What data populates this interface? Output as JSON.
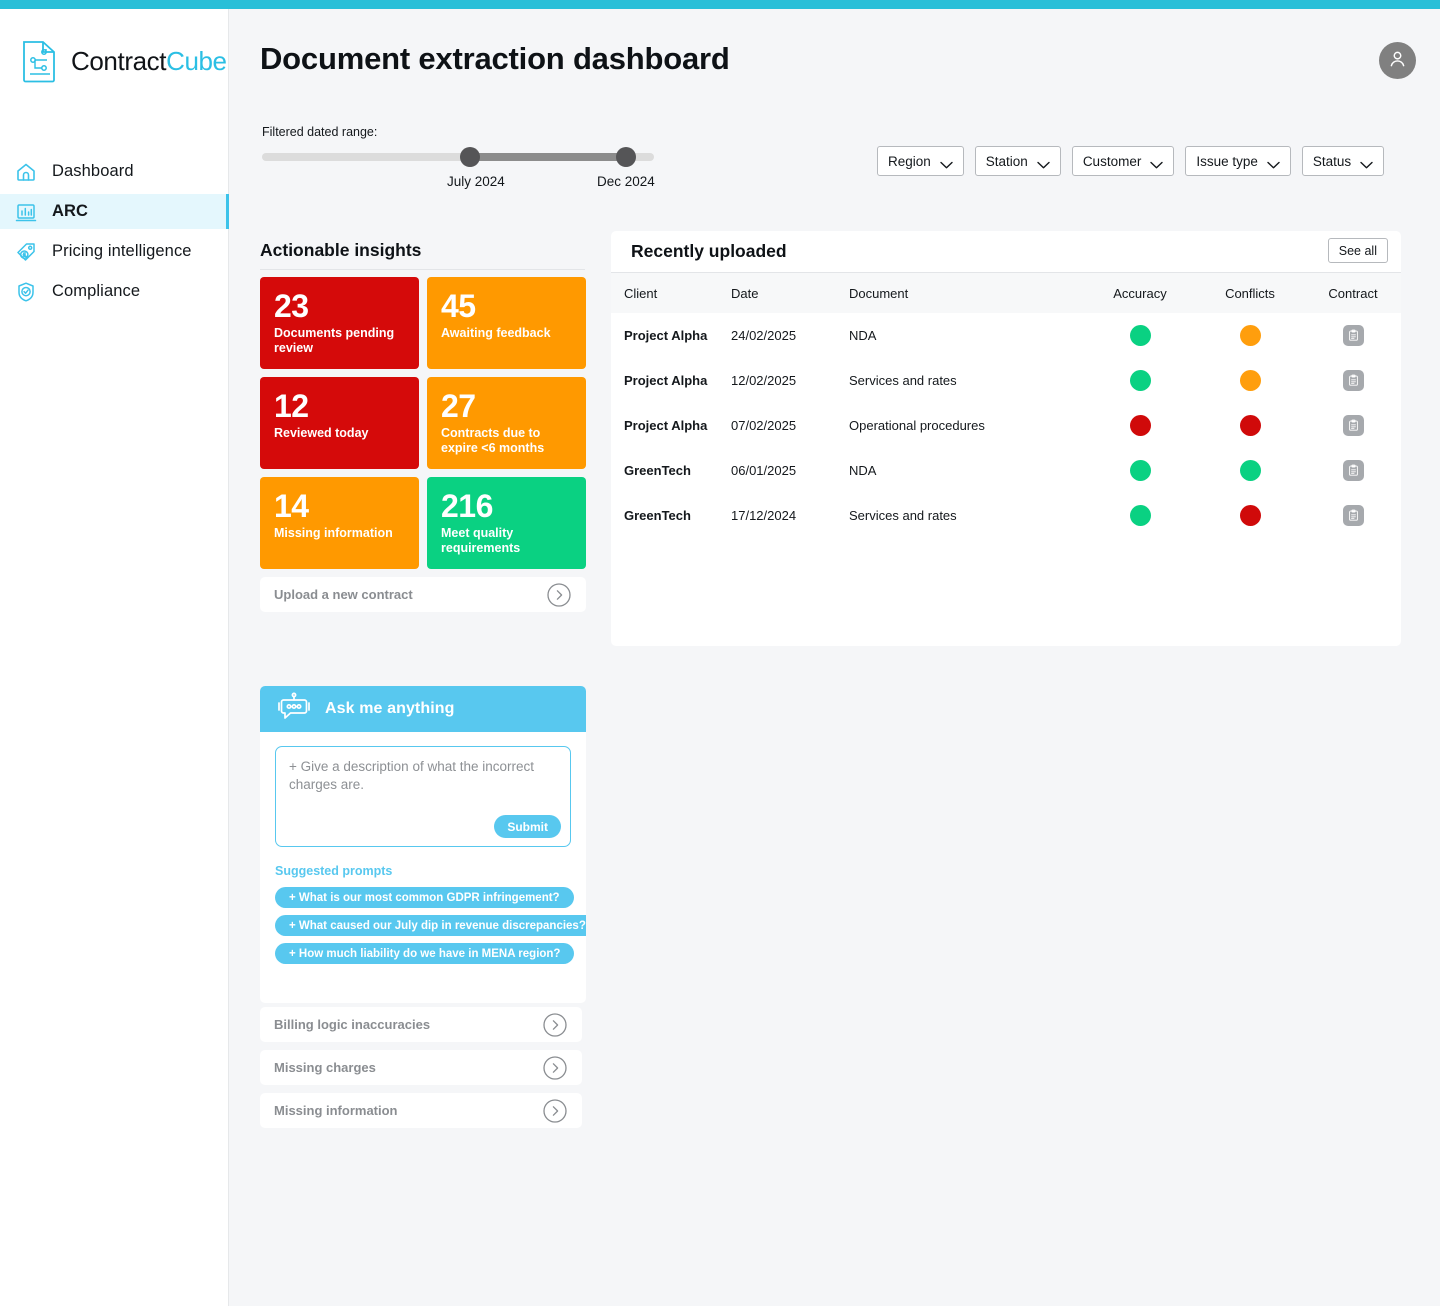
{
  "brand": {
    "name_part1": "Contract",
    "name_part2": "Cube",
    "accent": "#2bbfe4",
    "topbar_color": "#29bfd8"
  },
  "sidebar": {
    "items": [
      {
        "label": "Dashboard",
        "icon": "home-icon",
        "active": false
      },
      {
        "label": "ARC",
        "icon": "chart-monitor-icon",
        "active": true
      },
      {
        "label": "Pricing intelligence",
        "icon": "price-tag-icon",
        "active": false
      },
      {
        "label": "Compliance",
        "icon": "shield-check-icon",
        "active": false
      }
    ]
  },
  "header": {
    "title": "Document extraction dashboard",
    "avatar_icon": "user-avatar-icon"
  },
  "date_range": {
    "label": "Filtered dated range:",
    "start": "July 2024",
    "end": "Dec 2024"
  },
  "filters": [
    {
      "label": "Region",
      "icon": "chevron-down-icon"
    },
    {
      "label": "Station",
      "icon": "chevron-down-icon"
    },
    {
      "label": "Customer",
      "icon": "chevron-down-icon"
    },
    {
      "label": "Issue type",
      "icon": "chevron-down-icon"
    },
    {
      "label": "Status",
      "icon": "chevron-down-icon"
    }
  ],
  "insights": {
    "title": "Actionable insights",
    "tiles": [
      {
        "value": "23",
        "caption": "Documents pending review",
        "color": "red"
      },
      {
        "value": "45",
        "caption": "Awaiting feedback",
        "color": "orange"
      },
      {
        "value": "12",
        "caption": "Reviewed today",
        "color": "red"
      },
      {
        "value": "27",
        "caption": "Contracts due to expire <6 months",
        "color": "orange"
      },
      {
        "value": "14",
        "caption": "Missing information",
        "color": "orange"
      },
      {
        "value": "216",
        "caption": "Meet quality requirements",
        "color": "green"
      }
    ],
    "upload_label": "Upload a new contract"
  },
  "recently_uploaded": {
    "title": "Recently uploaded",
    "see_all_label": "See all",
    "columns": [
      "Client",
      "Date",
      "Document",
      "Accuracy",
      "Conflicts",
      "Contract"
    ],
    "rows": [
      {
        "client": "Project Alpha",
        "date": "24/02/2025",
        "document": "NDA",
        "accuracy": "green",
        "conflicts": "orange",
        "contract_icon": "clipboard-icon"
      },
      {
        "client": "Project Alpha",
        "date": "12/02/2025",
        "document": "Services and rates",
        "accuracy": "green",
        "conflicts": "orange",
        "contract_icon": "clipboard-icon"
      },
      {
        "client": "Project Alpha",
        "date": "07/02/2025",
        "document": "Operational procedures",
        "accuracy": "red",
        "conflicts": "red",
        "contract_icon": "clipboard-icon"
      },
      {
        "client": "GreenTech",
        "date": "06/01/2025",
        "document": "NDA",
        "accuracy": "green",
        "conflicts": "green",
        "contract_icon": "clipboard-icon"
      },
      {
        "client": "GreenTech",
        "date": "17/12/2024",
        "document": "Services and rates",
        "accuracy": "green",
        "conflicts": "red",
        "contract_icon": "clipboard-icon"
      }
    ]
  },
  "ask_me": {
    "title": "Ask me anything",
    "header_icon": "robot-icon",
    "input_placeholder": "+ Give a description of what the incorrect charges are.",
    "submit_label": "Submit",
    "suggested_title": "Suggested prompts",
    "prompts": [
      "+ What is our most common GDPR infringement?",
      "+ What caused our July dip in revenue discrepancies?",
      "+ How much liability do we have in MENA region?"
    ]
  },
  "quick_links": [
    {
      "label": "Billing logic inaccuracies"
    },
    {
      "label": "Missing charges"
    },
    {
      "label": "Missing information"
    }
  ],
  "colors": {
    "red": "#d50a0a",
    "orange": "#ff9900",
    "green": "#0ad182",
    "cyan": "#58c8ef"
  }
}
